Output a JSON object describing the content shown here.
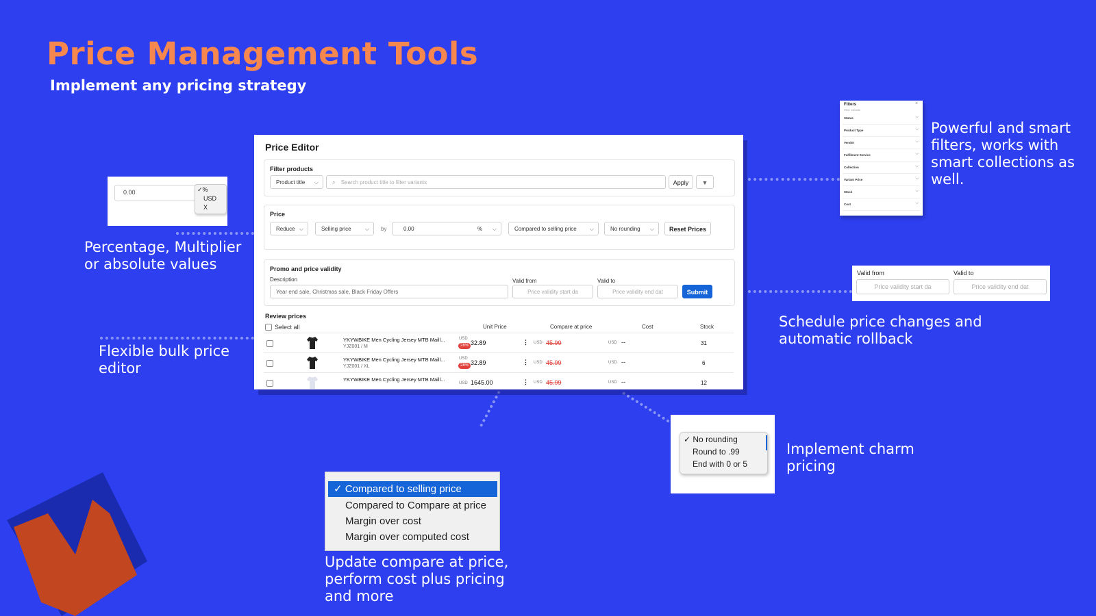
{
  "header": {
    "title": "Price Management Tools",
    "subtitle": "Implement any pricing strategy"
  },
  "captions": {
    "percentage": "Percentage, Multiplier or absolute values",
    "bulk": "Flexible bulk price editor",
    "filters": "Powerful and smart filters, works with smart collections as well.",
    "schedule": "Schedule price changes and automatic rollback",
    "charm": "Implement charm pricing",
    "compare": "Update compare at price, perform cost plus pricing and more"
  },
  "value_type_widget": {
    "value": "0.00",
    "options": [
      "%",
      "USD",
      "X"
    ],
    "selected": "%"
  },
  "editor": {
    "title": "Price Editor",
    "filter": {
      "label": "Filter products",
      "field_select": "Product title",
      "search_placeholder": "Search product title to filter variants",
      "apply_label": "Apply"
    },
    "price": {
      "label": "Price",
      "action": "Reduce",
      "target": "Selling price",
      "by_label": "by",
      "amount": "0.00",
      "unit": "%",
      "compare_mode": "Compared to selling price",
      "rounding": "No rounding",
      "reset_label": "Reset Prices"
    },
    "promo": {
      "label": "Promo and price validity",
      "description_label": "Description",
      "description_placeholder": "Year end sale, Christmas sale, Black Friday Offers",
      "valid_from_label": "Valid from",
      "valid_from_placeholder": "Price validity start da",
      "valid_to_label": "Valid to",
      "valid_to_placeholder": "Price validity end dat",
      "submit_label": "Submit"
    },
    "review": {
      "label": "Review prices",
      "select_all": "Select all",
      "columns": [
        "Unit Price",
        "Compare at price",
        "Cost",
        "Stock"
      ],
      "rows": [
        {
          "name": "YKYWBIKE Men Cycling Jersey MTB Maill...",
          "sku": "YJZ001 / M",
          "currency": "USD",
          "discount": "28%",
          "unit_price": "32.89",
          "compare_currency": "USD",
          "compare_price": "45.99",
          "cost_currency": "USD",
          "cost": "--",
          "stock": "31"
        },
        {
          "name": "YKYWBIKE Men Cycling Jersey MTB Maill...",
          "sku": "YJZ001 / XL",
          "currency": "USD",
          "discount": "28%",
          "unit_price": "32.89",
          "compare_currency": "USD",
          "compare_price": "45.99",
          "cost_currency": "USD",
          "cost": "--",
          "stock": "6"
        },
        {
          "name": "YKYWBIKE Men Cycling Jersey MTB Maill...",
          "sku": "",
          "currency": "USD",
          "discount": "",
          "unit_price": "1645.00",
          "compare_currency": "USD",
          "compare_price": "45.99",
          "cost_currency": "USD",
          "cost": "--",
          "stock": "12"
        }
      ]
    }
  },
  "filters_panel": {
    "title": "Filters",
    "subtitle": "Filter variants",
    "items": [
      "Status",
      "Product Type",
      "Vendor",
      "Fulfilment Service",
      "Collection",
      "Variant Price",
      "Stock",
      "Cost"
    ]
  },
  "validity_widget": {
    "from_label": "Valid from",
    "from_placeholder": "Price validity start da",
    "to_label": "Valid to",
    "to_placeholder": "Price validity end dat"
  },
  "rounding_menu": {
    "items": [
      "No rounding",
      "Round to .99",
      "End with 0 or 5"
    ],
    "selected": "No rounding"
  },
  "compare_menu": {
    "items": [
      "Compared to selling price",
      "Compared to Compare at price",
      "Margin over cost",
      "Margin over computed cost"
    ],
    "selected": "Compared to selling price"
  },
  "colors": {
    "background": "#2e3ff0",
    "title": "#f5874f",
    "primary_button": "#1565d8",
    "discount_badge": "#e2403a"
  }
}
